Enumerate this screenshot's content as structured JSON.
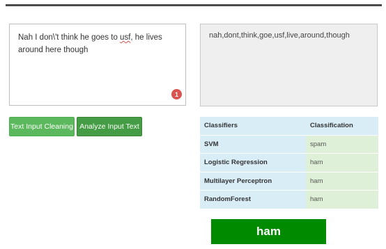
{
  "input": {
    "text_before": "Nah I don\\'t think he goes to ",
    "misspelled": "usf",
    "text_after": ", he lives around here though",
    "spell_errors": "1"
  },
  "output": {
    "cleaned": "nah,dont,think,goe,usf,live,around,though"
  },
  "buttons": {
    "clean_label": "Text Input Cleaning",
    "analyze_label": "Analyze Input Text"
  },
  "table": {
    "headers": [
      "Classifiers",
      "Classification"
    ],
    "rows": [
      {
        "classifier": "SVM",
        "classification": "spam"
      },
      {
        "classifier": "Logistic Regression",
        "classification": "ham"
      },
      {
        "classifier": "Multilayer Perceptron",
        "classification": "ham"
      },
      {
        "classifier": "RandomForest",
        "classification": "ham"
      }
    ]
  },
  "result": {
    "label": "ham"
  },
  "colors": {
    "primary_button": "#5cb85c",
    "analyze_button": "#449d44",
    "result_bg": "#008a00",
    "header_bg": "#d9edf7",
    "value_bg": "#dff0d8",
    "error_badge": "#d9534f"
  }
}
